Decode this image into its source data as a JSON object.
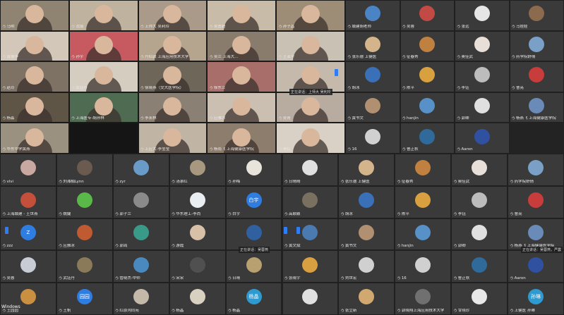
{
  "colors": {
    "background": "#232323",
    "tile": "#3a3a3a",
    "pin": "#2f7df6",
    "text": "#e8e8e8"
  },
  "mic_glyph": "ろ",
  "video_tiles": [
    {
      "name": "马明",
      "tone": "#8f8372"
    },
    {
      "name": "沈丽",
      "tone": "#bfb29f"
    },
    {
      "name": "上师大 吴利玲",
      "tone": "#a99a89"
    },
    {
      "name": "吴勇超",
      "tone": "#c8bba8"
    },
    {
      "name": "孙子昌",
      "tone": "#9d8d76"
    },
    {
      "name": "黄振华",
      "tone": "#d2c7b8"
    },
    {
      "name": "孙宇",
      "tone": "#c65a60"
    },
    {
      "name": "丹伯敦 上海应用技术大学",
      "tone": "#b6a58e"
    },
    {
      "name": "吴兰 上海大...",
      "tone": "#8a7c6c"
    },
    {
      "name": "王亚宇",
      "tone": "#c9c1b3"
    },
    {
      "name": "赵玲",
      "tone": "#7e7264"
    },
    {
      "name": "武钰丹",
      "tone": "#d6cdc1"
    },
    {
      "name": "徐晓燕（交大医学院）",
      "tone": "#6e6659"
    },
    {
      "name": "徐东兰",
      "tone": "#a86f6a"
    },
    {
      "name": "",
      "tone": "#c4b9ab"
    },
    {
      "name": "杨淼",
      "tone": "#5f5547"
    },
    {
      "name": "上海医专-胡孙林",
      "tone": "#4f6b52"
    },
    {
      "name": "李永林",
      "tone": "#8a8174"
    },
    {
      "name": "应雅冰",
      "tone": "#cbbfb2"
    },
    {
      "name": "吴青",
      "tone": "#b8aca0"
    },
    {
      "name": "华东中学黄燕",
      "tone": "#9b9180"
    },
    {
      "name": "",
      "tone": "#151515"
    },
    {
      "name": "上应大-李莹莹",
      "tone": "#c0b4a4"
    },
    {
      "name": "杨雨飞 上海健康医学院",
      "tone": "#8c7d6d"
    },
    {
      "name": "李红",
      "tone": "#d9d1c6"
    }
  ],
  "top_avatars": [
    {
      "name": "城建胡老师",
      "color": "#4a84c5"
    },
    {
      "name": "吴蓉",
      "color": "#c24a44"
    },
    {
      "name": "张远",
      "color": "#e6e6e6"
    },
    {
      "name": "马娃娃",
      "color": "#8b6a4d"
    },
    {
      "name": "张乐德 上健医",
      "color": "#d4b48a"
    },
    {
      "name": "征春秀",
      "color": "#c08040"
    },
    {
      "name": "奥佳武",
      "color": "#e8e0d8"
    },
    {
      "name": "药学院舒倩",
      "color": "#7aa0c8"
    },
    {
      "name": "胡冰",
      "color": "#3a70b8"
    },
    {
      "name": "陈平",
      "color": "#d9a040"
    },
    {
      "name": "李钰",
      "color": "#bcbcbc"
    },
    {
      "name": "曹亮",
      "color": "#c83c3c"
    },
    {
      "name": "黄书文",
      "color": "#b09070"
    },
    {
      "name": "hanjin",
      "color": "#5890c8"
    },
    {
      "name": "郭卿",
      "color": "#e0e0e0"
    },
    {
      "name": "杨燕飞 上海健康医学院",
      "color": "#6a8ab8"
    },
    {
      "name": "16",
      "color": "#d0d0d0"
    },
    {
      "name": "曹正秋",
      "color": "#2f6a9a"
    },
    {
      "name": "Aaron",
      "color": "#3050a0"
    }
  ],
  "grid_rows": [
    [
      {
        "name": "vivi",
        "color": "#c8a8a0"
      },
      {
        "name": "刘湘楠Lynn",
        "color": "#6a5a50"
      },
      {
        "name": "zyr",
        "color": "#6a9ac8"
      },
      {
        "name": "汤承红",
        "color": "#a89880"
      },
      {
        "name": "孙梅",
        "color": "#e8e4dc"
      },
      {
        "name": "日晴晴",
        "color": "#e0e0e0"
      },
      {
        "name": "张乐德 上健医",
        "color": "#d4b48a"
      },
      {
        "name": "征春秀",
        "color": "#c08040"
      },
      {
        "name": "奥佳武",
        "color": "#e8e0d8"
      },
      {
        "name": "药学院舒倩",
        "color": "#7aa0c8"
      }
    ],
    [
      {
        "name": "上海城建 - 王世燕",
        "color": "#c4503c"
      },
      {
        "name": "姚婕",
        "color": "#5ab848"
      },
      {
        "name": "郭子兰",
        "color": "#8a8a8a"
      },
      {
        "name": "华东理工-李尚",
        "color": "#e8eef2"
      },
      {
        "name": "白宇",
        "color": "#2f7de0",
        "text": "白宇"
      },
      {
        "name": "高颖颖",
        "color": "#7a7060"
      },
      {
        "name": "胡冰",
        "color": "#3a70b8"
      },
      {
        "name": "陈平",
        "color": "#d9a040"
      },
      {
        "name": "李钰",
        "color": "#bcbcbc"
      },
      {
        "name": "曹亮",
        "color": "#c83c3c"
      }
    ],
    [
      {
        "name": "zzz",
        "color": "#2f7de0",
        "text": "Z"
      },
      {
        "name": "应雅冰",
        "color": "#c05a30"
      },
      {
        "name": "郭鸽",
        "color": "#3a9a8a"
      },
      {
        "name": "游霞",
        "color": "#d8c0a8"
      },
      {
        "name": "",
        "color": "#3060a0"
      },
      {
        "name": "黄文斌",
        "color": "#4a7ab0"
      },
      {
        "name": "黄书文",
        "color": "#b09070"
      },
      {
        "name": "hanjin",
        "color": "#5890c8"
      },
      {
        "name": "郭卿",
        "color": "#e0e0e0"
      },
      {
        "name": "杨燕飞 上海健康医学院",
        "color": "#6a8ab8"
      }
    ],
    [
      {
        "name": "吴蓉",
        "color": "#c8ccd4"
      },
      {
        "name": "武钰丹",
        "color": "#8a7a5a"
      },
      {
        "name": "管晓杰-中师",
        "color": "#4a88c0"
      },
      {
        "name": "宋宋",
        "color": "#505050"
      },
      {
        "name": "日晴",
        "color": "#b8a070"
      },
      {
        "name": "张晓宇",
        "color": "#d8a040"
      },
      {
        "name": "刘世宏",
        "color": "#d0d0d0"
      },
      {
        "name": "16",
        "color": "#d0d0d0"
      },
      {
        "name": "曹正秋",
        "color": "#2f6a9a"
      },
      {
        "name": "Aaron",
        "color": "#3050a0"
      }
    ],
    [
      {
        "name": "王园园",
        "color": "#c89040"
      },
      {
        "name": "王帆",
        "color": "#2f7de0",
        "text": "园园"
      },
      {
        "name": "红原沟同苑",
        "color": "#c4b8a8"
      },
      {
        "name": "杨晶",
        "color": "#d8d0c0"
      },
      {
        "name": "杨晶",
        "color": "#2f9ad0",
        "text": "杨晶"
      },
      {
        "name": "",
        "color": "#e0e0e0"
      },
      {
        "name": "张立新",
        "color": "#d0a870"
      },
      {
        "name": "郭晓翔上海应用技术大学",
        "color": "#707070"
      },
      {
        "name": "甘晓珍",
        "color": "#e8e8e8"
      },
      {
        "name": "上健医 孙琳",
        "color": "#2f9ad0",
        "text": "孙琳"
      }
    ]
  ],
  "hover_tips": [
    "正在讲话：上师大 吴利玲",
    "正在讲话：吴蓉燕",
    "正在讲话：吴蓉燕，严震"
  ],
  "app_label": "Windows"
}
